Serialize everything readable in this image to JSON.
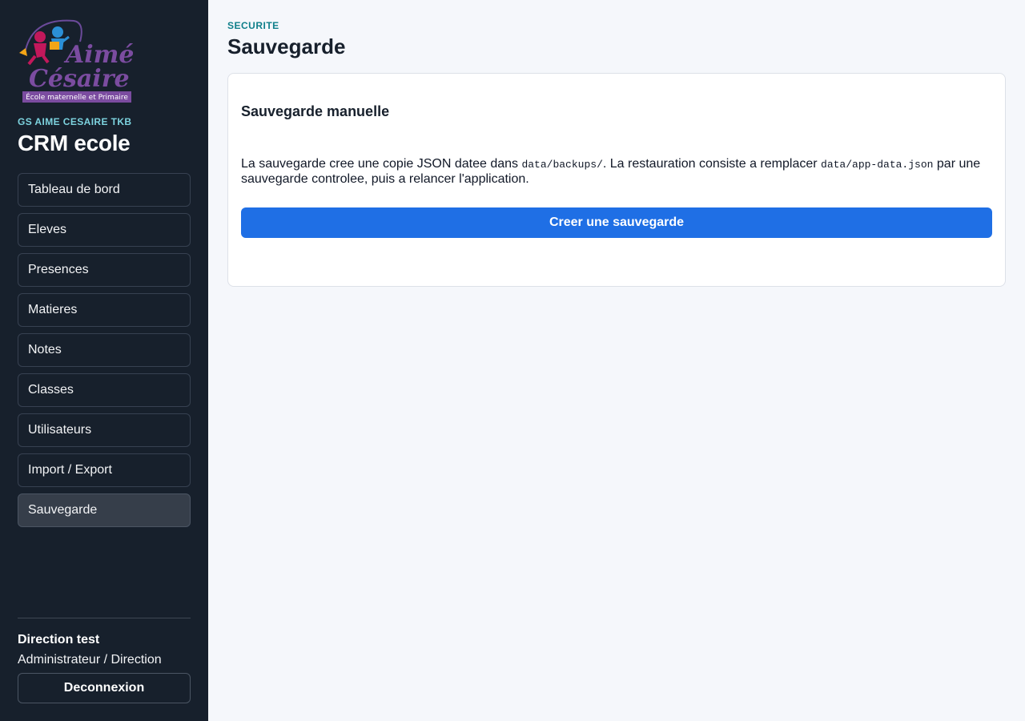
{
  "sidebar": {
    "logo": {
      "line1": "Aimé",
      "line2": "Césaire",
      "tagline": "École maternelle et Primaire"
    },
    "school_name": "GS AIME CESAIRE TKB",
    "app_title": "CRM ecole",
    "nav": [
      {
        "label": "Tableau de bord"
      },
      {
        "label": "Eleves"
      },
      {
        "label": "Presences"
      },
      {
        "label": "Matieres"
      },
      {
        "label": "Notes"
      },
      {
        "label": "Classes"
      },
      {
        "label": "Utilisateurs"
      },
      {
        "label": "Import / Export"
      },
      {
        "label": "Sauvegarde",
        "active": true
      }
    ],
    "user": {
      "name": "Direction test",
      "role": "Administrateur / Direction"
    },
    "logout_label": "Deconnexion"
  },
  "header": {
    "eyebrow": "SECURITE",
    "title": "Sauvegarde"
  },
  "card": {
    "title": "Sauvegarde manuelle",
    "text_1": "La sauvegarde cree une copie JSON datee dans ",
    "code_1": "data/backups/",
    "text_2": ". La restauration consiste a remplacer ",
    "code_2": "data/app-data.json",
    "text_3": " par une sauvegarde controlee, puis a relancer l'application.",
    "button_label": "Creer une sauvegarde"
  },
  "colors": {
    "sidebar_bg": "#17202c",
    "accent": "#1f6fe5",
    "eyebrow": "#0f7f8a",
    "school_name": "#7dd3df"
  }
}
